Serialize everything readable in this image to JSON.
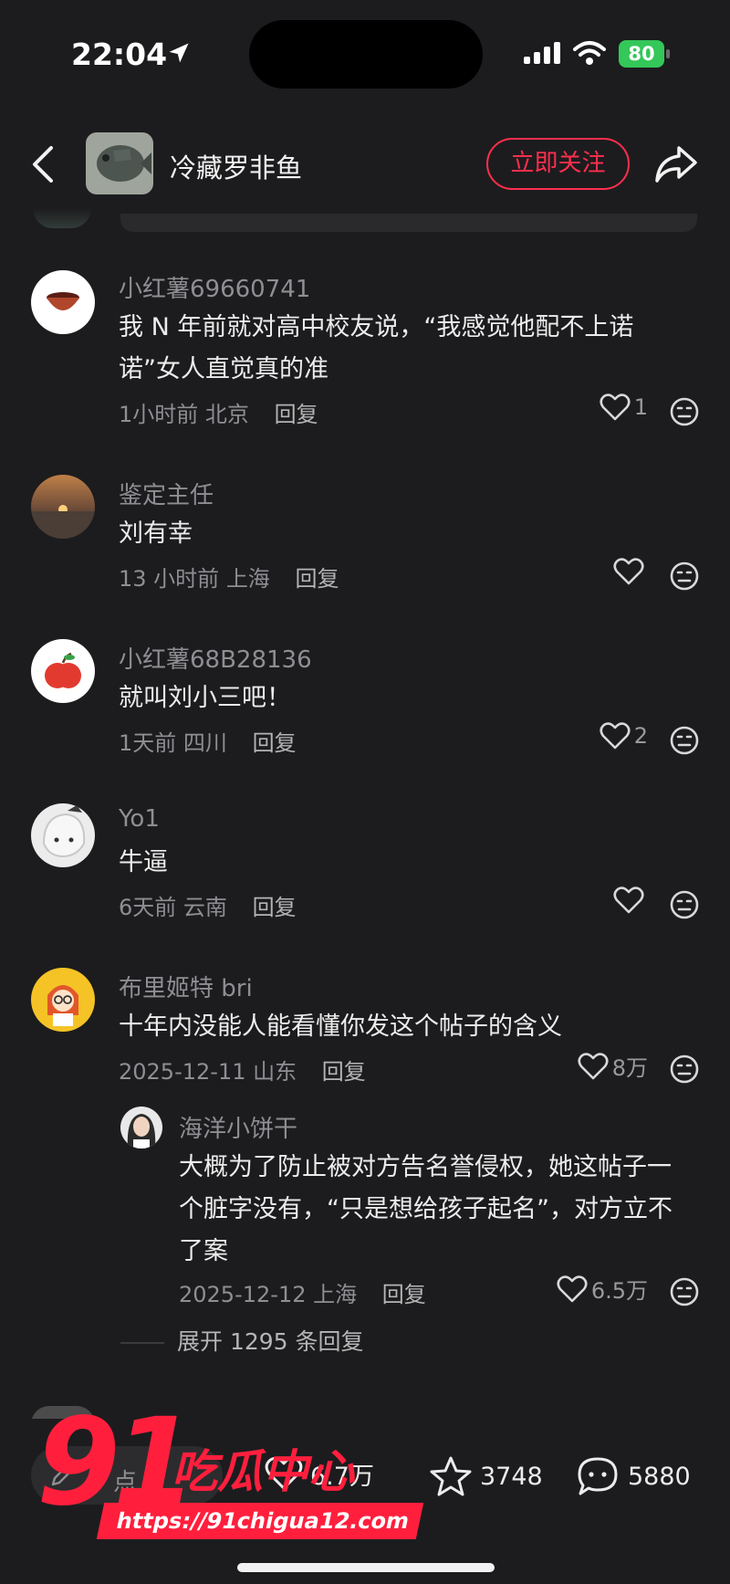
{
  "status_bar": {
    "time": "22:04",
    "battery": "80"
  },
  "header": {
    "author_name": "冷藏罗非鱼",
    "follow_label": "立即关注"
  },
  "comments": [
    {
      "name": "小红薯69660741",
      "text": "我 N 年前就对高中校友说，“我感觉他配不上诺诺”女人直觉真的准",
      "time": "1小时前",
      "location": "北京",
      "reply_label": "回复",
      "likes": "1"
    },
    {
      "name": "鉴定主任",
      "text": "刘有幸",
      "time": "13 小时前",
      "location": "上海",
      "reply_label": "回复",
      "likes": ""
    },
    {
      "name": "小红薯68B28136",
      "text": "就叫刘小三吧！",
      "time": "1天前",
      "location": "四川",
      "reply_label": "回复",
      "likes": "2"
    },
    {
      "name": "Yo1",
      "text": "牛逼",
      "time": "6天前",
      "location": "云南",
      "reply_label": "回复",
      "likes": ""
    },
    {
      "name": "布里姬特 bri",
      "text": "十年内没能人能看懂你发这个帖子的含义",
      "time": "2025-12-11",
      "location": "山东",
      "reply_label": "回复",
      "likes": "8万"
    }
  ],
  "sub_comment": {
    "name": "海洋小饼干",
    "text": "大概为了防止被对方告名誉侵权，她这帖子一个脏字没有，“只是想给孩子起名”，对方立不了案",
    "time": "2025-12-12",
    "location": "上海",
    "reply_label": "回复",
    "likes": "6.5万"
  },
  "expand_label": "展开 1295 条回复",
  "bottom_bar": {
    "input_placeholder": "点",
    "likes": "6.7万",
    "favorites": "3748",
    "comments": "5880"
  },
  "watermark": {
    "number": "91",
    "title": "吃瓜中心",
    "url": "https://91chigua12.com"
  },
  "colors": {
    "accent": "#ff2e4d",
    "background": "#1c1c1e",
    "watermark": "#ff1f3d",
    "battery": "#34c759"
  },
  "icons": [
    "location-arrow-icon",
    "signal-icon",
    "wifi-icon",
    "back-icon",
    "share-icon",
    "heart-icon",
    "emoji-icon",
    "star-icon",
    "comment-icon",
    "pencil-icon"
  ]
}
